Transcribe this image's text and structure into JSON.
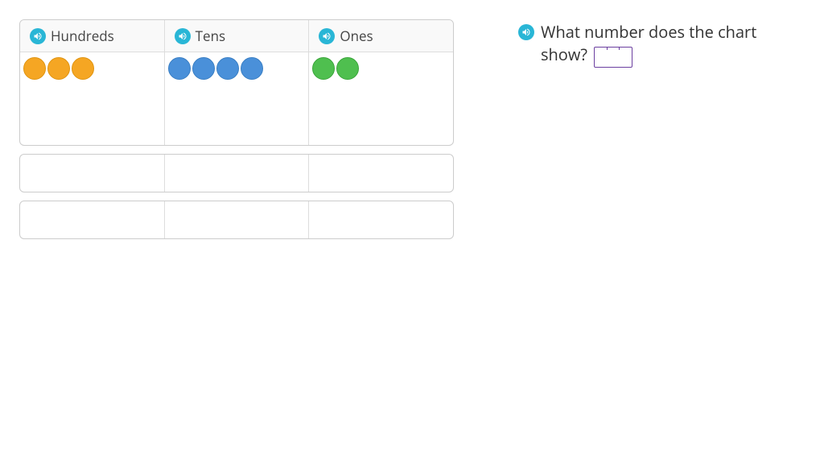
{
  "chart": {
    "headers": {
      "hundreds": "Hundreds",
      "tens": "Tens",
      "ones": "Ones"
    },
    "counts": {
      "hundreds": 3,
      "tens": 4,
      "ones": 2
    }
  },
  "question": {
    "text": "What number does the chart show?"
  },
  "colors": {
    "hundreds": "#f5a623",
    "tens": "#4a90d9",
    "ones": "#4fbf4f",
    "audio_icon": "#29b6d6",
    "input_border": "#6b3fa0"
  }
}
